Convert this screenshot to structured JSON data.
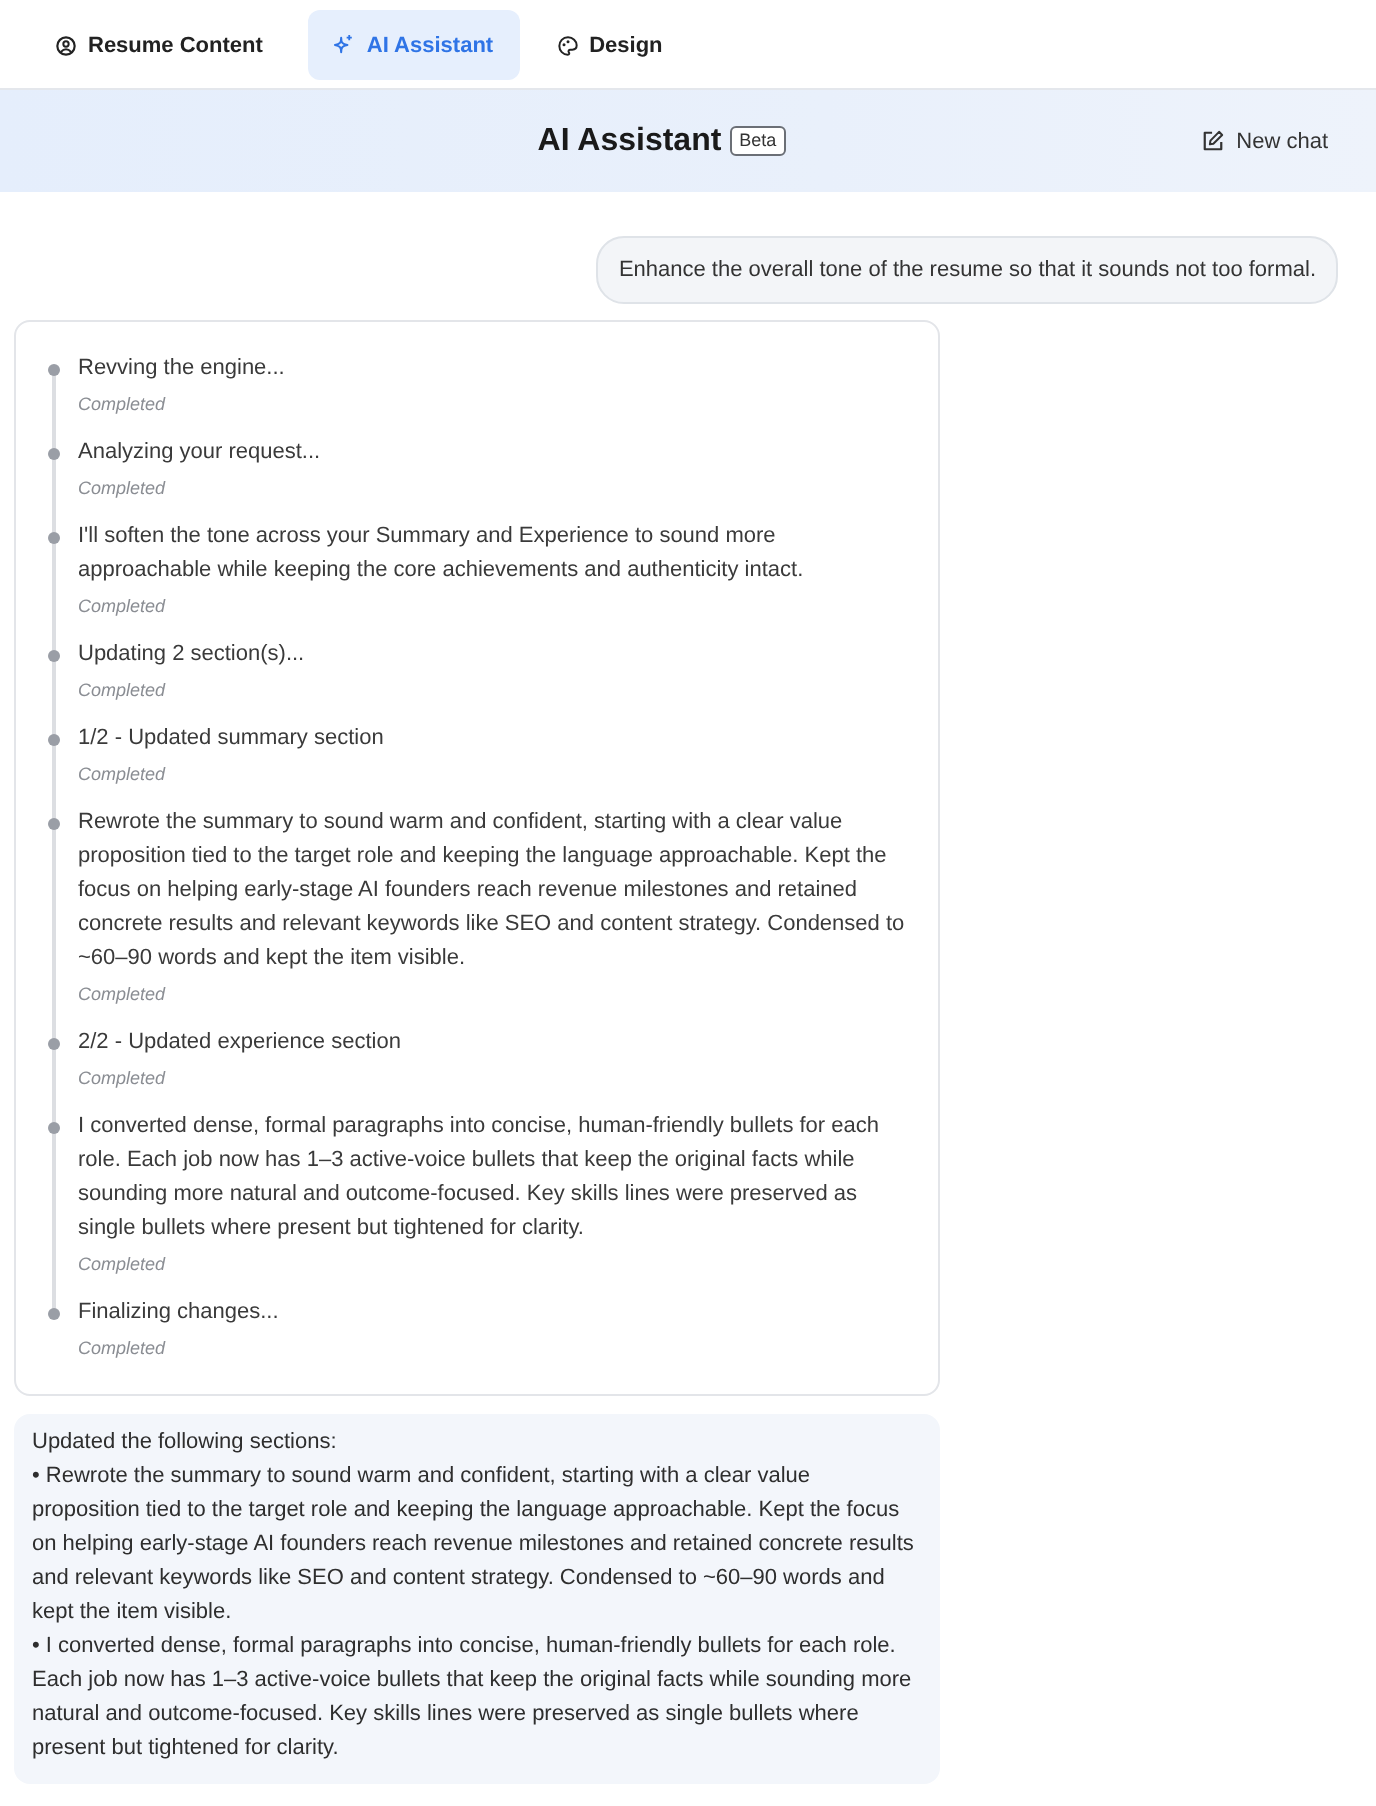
{
  "tabs": [
    {
      "label": "Resume Content",
      "selected": false
    },
    {
      "label": "AI Assistant",
      "selected": true
    },
    {
      "label": "Design",
      "selected": false
    }
  ],
  "header": {
    "title": "AI Assistant",
    "badge": "Beta",
    "new_chat": "New chat"
  },
  "user_message": "Enhance the overall tone of the resume so that it sounds not too formal.",
  "steps": [
    {
      "title": "Revving the engine...",
      "status": "Completed"
    },
    {
      "title": "Analyzing your request...",
      "status": "Completed"
    },
    {
      "title": "I'll soften the tone across your Summary and Experience to sound more approachable while keeping the core achievements and authenticity intact.",
      "status": "Completed"
    },
    {
      "title": "Updating 2 section(s)...",
      "status": "Completed"
    },
    {
      "title": "1/2 - Updated summary section",
      "status": "Completed"
    },
    {
      "title": "Rewrote the summary to sound warm and confident, starting with a clear value proposition tied to the target role and keeping the language approachable. Kept the focus on helping early-stage AI founders reach revenue milestones and retained concrete results and relevant keywords like SEO and content strategy. Condensed to ~60–90 words and kept the item visible.",
      "status": "Completed"
    },
    {
      "title": "2/2 - Updated experience section",
      "status": "Completed"
    },
    {
      "title": "I converted dense, formal paragraphs into concise, human-friendly bullets for each role. Each job now has 1–3 active-voice bullets that keep the original facts while sounding more natural and outcome-focused. Key skills lines were preserved as single bullets where present but tightened for clarity.",
      "status": "Completed"
    },
    {
      "title": "Finalizing changes...",
      "status": "Completed"
    }
  ],
  "summary": {
    "heading": "Updated the following sections:",
    "items": [
      "• Rewrote the summary to sound warm and confident, starting with a clear value proposition tied to the target role and keeping the language approachable. Kept the focus on helping early-stage AI founders reach revenue milestones and retained concrete results and relevant keywords like SEO and content strategy. Condensed to ~60–90 words and kept the item visible.",
      "• I converted dense, formal paragraphs into concise, human-friendly bullets for each role. Each job now has 1–3 active-voice bullets that keep the original facts while sounding more natural and outcome-focused. Key skills lines were preserved as single bullets where present but tightened for clarity."
    ]
  }
}
